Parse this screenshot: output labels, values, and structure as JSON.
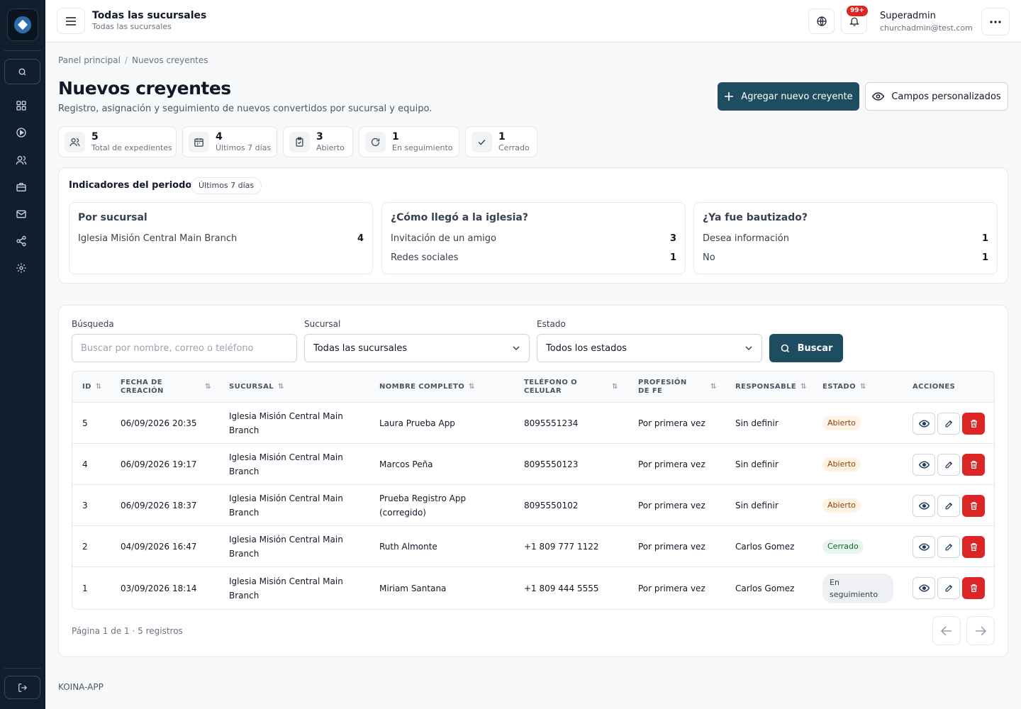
{
  "topbar": {
    "title": "Todas las sucursales",
    "subtitle": "Todas las sucursales",
    "notifications": "99+",
    "user_name": "Superadmin",
    "user_email": "churchadmin@test.com"
  },
  "breadcrumb": {
    "home": "Panel principal",
    "separator": "/",
    "current": "Nuevos creyentes"
  },
  "page": {
    "title": "Nuevos creyentes",
    "description": "Registro, asignación y seguimiento de nuevos convertidos por sucursal y equipo.",
    "add_label": "Agregar nuevo creyente",
    "custom_fields_label": "Campos personalizados"
  },
  "stats": [
    {
      "value": "5",
      "label": "Total de expedientes",
      "icon": "users-icon"
    },
    {
      "value": "4",
      "label": "Últimos 7 días",
      "icon": "calendar-icon"
    },
    {
      "value": "3",
      "label": "Abierto",
      "icon": "clipboard-icon"
    },
    {
      "value": "1",
      "label": "En seguimiento",
      "icon": "refresh-icon"
    },
    {
      "value": "1",
      "label": "Cerrado",
      "icon": "check-icon"
    }
  ],
  "indicators": {
    "title": "Indicadores del periodo",
    "period": "Últimos 7 días",
    "cards": [
      {
        "title": "Por sucursal",
        "rows": [
          {
            "label": "Iglesia Misión Central Main Branch",
            "value": "4"
          }
        ]
      },
      {
        "title": "¿Cómo llegó a la iglesia?",
        "rows": [
          {
            "label": "Invitación de un amigo",
            "value": "3"
          },
          {
            "label": "Redes sociales",
            "value": "1"
          }
        ]
      },
      {
        "title": "¿Ya fue bautizado?",
        "rows": [
          {
            "label": "Desea información",
            "value": "1"
          },
          {
            "label": "No",
            "value": "1"
          }
        ]
      }
    ]
  },
  "filters": {
    "search_label": "Búsqueda",
    "search_placeholder": "Buscar por nombre, correo o teléfono",
    "search_value": "",
    "branch_label": "Sucursal",
    "branch_value": "Todas las sucursales",
    "status_label": "Estado",
    "status_value": "Todos los estados",
    "search_button": "Buscar"
  },
  "table": {
    "headers": {
      "id": "ID",
      "created": "FECHA DE CREACIÓN",
      "branch": "SUCURSAL",
      "name": "NOMBRE COMPLETO",
      "phone": "TELÉFONO O CELULAR",
      "profession": "PROFESIÓN DE FE",
      "owner": "RESPONSABLE",
      "status": "ESTADO",
      "actions": "ACCIONES"
    },
    "rows": [
      {
        "id": "5",
        "created": "06/09/2026 20:35",
        "branch": "Iglesia Misión Central Main Branch",
        "name": "Laura Prueba App",
        "phone": "8095551234",
        "profession": "Por primera vez",
        "owner": "Sin definir",
        "status": "Abierto"
      },
      {
        "id": "4",
        "created": "06/09/2026 19:17",
        "branch": "Iglesia Misión Central Main Branch",
        "name": "Marcos Peña",
        "phone": "8095550123",
        "profession": "Por primera vez",
        "owner": "Sin definir",
        "status": "Abierto"
      },
      {
        "id": "3",
        "created": "06/09/2026 18:37",
        "branch": "Iglesia Misión Central Main Branch",
        "name": "Prueba Registro App (corregido)",
        "phone": "8095550102",
        "profession": "Por primera vez",
        "owner": "Sin definir",
        "status": "Abierto"
      },
      {
        "id": "2",
        "created": "04/09/2026 16:47",
        "branch": "Iglesia Misión Central Main Branch",
        "name": "Ruth Almonte",
        "phone": "+1 809 777 1122",
        "profession": "Por primera vez",
        "owner": "Carlos Gomez",
        "status": "Cerrado"
      },
      {
        "id": "1",
        "created": "03/09/2026 18:14",
        "branch": "Iglesia Misión Central Main Branch",
        "name": "Miriam Santana",
        "phone": "+1 809 444 5555",
        "profession": "Por primera vez",
        "owner": "Carlos Gomez",
        "status": "En seguimiento"
      }
    ]
  },
  "pagination": {
    "text": "Página 1 de 1 · 5 registros"
  },
  "footer": {
    "text": "KOINA-APP"
  },
  "colors": {
    "sidebar": "#0f1f2e",
    "primary": "#1e4d5f",
    "danger": "#dc2626"
  }
}
